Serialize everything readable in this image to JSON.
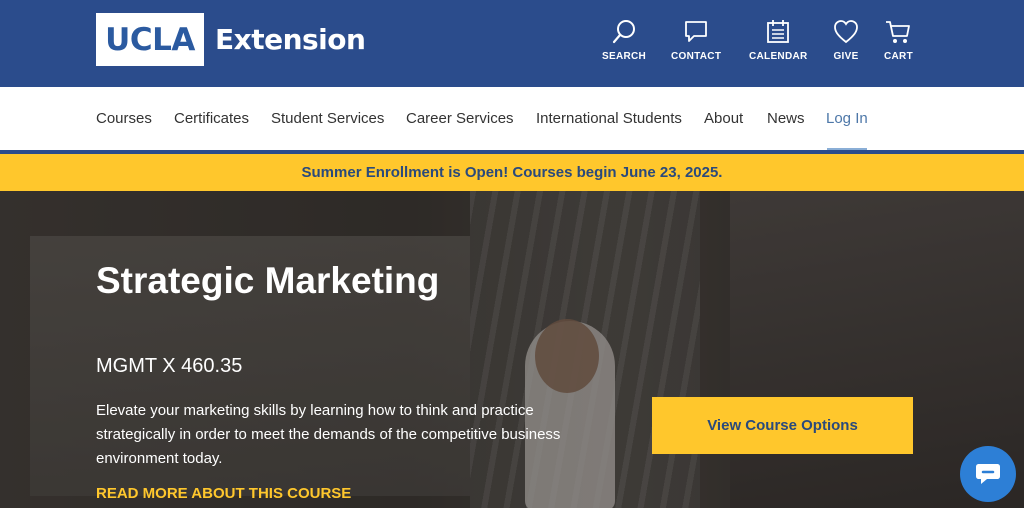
{
  "header": {
    "logo_ucla": "UCLA",
    "logo_extension": "Extension",
    "utility": [
      {
        "label": "SEARCH",
        "icon": "search-icon"
      },
      {
        "label": "CONTACT",
        "icon": "chat-bubble-icon"
      },
      {
        "label": "CALENDAR",
        "icon": "calendar-icon"
      },
      {
        "label": "GIVE",
        "icon": "heart-icon"
      },
      {
        "label": "CART",
        "icon": "cart-icon"
      }
    ]
  },
  "nav": {
    "items": [
      "Courses",
      "Certificates",
      "Student Services",
      "Career Services",
      "International Students",
      "About",
      "News"
    ],
    "login": "Log In"
  },
  "banner": {
    "text": "Summer Enrollment is Open! Courses begin June 23, 2025."
  },
  "hero": {
    "title": "Strategic Marketing",
    "code": "MGMT X 460.35",
    "description": "Elevate your marketing skills by learning how to think and practice strategically in order to meet the demands of the competitive business environment today.",
    "read_more": "READ MORE ABOUT THIS COURSE",
    "cta": "View Course Options"
  },
  "chat": {
    "icon": "chat-icon"
  },
  "colors": {
    "primary_blue": "#2b4c8c",
    "accent_gold": "#ffc72c",
    "link_blue": "#4d77a8",
    "chat_blue": "#2d7fd6"
  }
}
